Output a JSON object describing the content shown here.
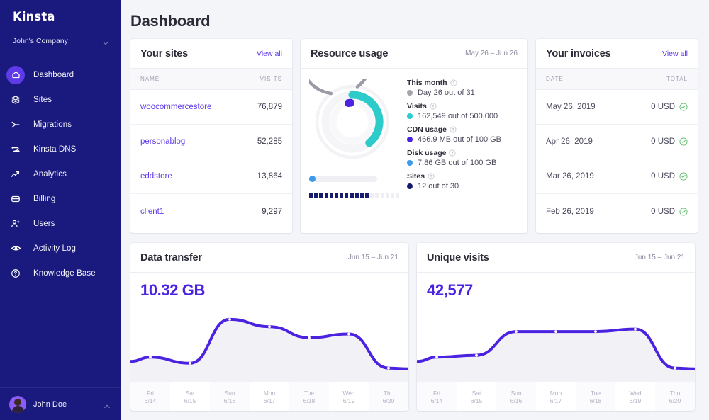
{
  "sidebar": {
    "logo": "Kinsta",
    "company": "John's Company",
    "company_chevron_icon": "chevron-down-icon",
    "items": [
      {
        "label": "Dashboard",
        "icon": "home-icon",
        "active": true
      },
      {
        "label": "Sites",
        "icon": "layers-icon",
        "active": false
      },
      {
        "label": "Migrations",
        "icon": "arrow-merge-icon",
        "active": false
      },
      {
        "label": "Kinsta DNS",
        "icon": "dns-network-icon",
        "active": false
      },
      {
        "label": "Analytics",
        "icon": "trend-up-icon",
        "active": false
      },
      {
        "label": "Billing",
        "icon": "credit-card-icon",
        "active": false
      },
      {
        "label": "Users",
        "icon": "user-plus-icon",
        "active": false
      },
      {
        "label": "Activity Log",
        "icon": "eye-icon",
        "active": false
      },
      {
        "label": "Knowledge Base",
        "icon": "question-circle-icon",
        "active": false
      }
    ],
    "user": {
      "name": "John Doe",
      "chevron_icon": "chevron-up-icon"
    }
  },
  "header": {
    "title": "Dashboard"
  },
  "sites_card": {
    "title": "Your sites",
    "view_all": "View all",
    "columns": [
      "NAME",
      "VISITS"
    ],
    "rows": [
      {
        "name": "woocommercestore",
        "visits": "76,879"
      },
      {
        "name": "personablog",
        "visits": "52,285"
      },
      {
        "name": "eddstore",
        "visits": "13,864"
      },
      {
        "name": "client1",
        "visits": "9,297"
      }
    ]
  },
  "resource_card": {
    "title": "Resource usage",
    "date_range": "May 26 – Jun 26",
    "help_icon": "question-circle-icon",
    "metrics": [
      {
        "label": "This month",
        "value": "Day 26 out of 31",
        "color": "#a3a3ad",
        "fraction": 0.839
      },
      {
        "label": "Visits",
        "value": "162,549 out of 500,000",
        "color": "#2ecbcb",
        "fraction": 0.325
      },
      {
        "label": "CDN usage",
        "value": "466.9 MB out of 100 GB",
        "color": "#4a22e0",
        "fraction": 0.0047
      },
      {
        "label": "Disk usage",
        "value": "7.86 GB out of 100 GB",
        "color": "#3b9aea",
        "fraction": 0.0786
      },
      {
        "label": "Sites",
        "value": "12 out of 30",
        "color": "#151b6e",
        "fraction": 0.4
      }
    ],
    "sites_segments_total": 18,
    "sites_segments_filled": 12
  },
  "invoices_card": {
    "title": "Your invoices",
    "view_all": "View all",
    "columns": [
      "DATE",
      "TOTAL"
    ],
    "status_icon": "check-circle-icon",
    "rows": [
      {
        "date": "May 26, 2019",
        "total": "0 USD"
      },
      {
        "date": "Apr 26, 2019",
        "total": "0 USD"
      },
      {
        "date": "Mar 26, 2019",
        "total": "0 USD"
      },
      {
        "date": "Feb 26, 2019",
        "total": "0 USD"
      }
    ]
  },
  "chart_data": [
    {
      "type": "area",
      "title": "Data transfer",
      "subtitle": "Jun 15 – Jun 21",
      "value_label": "10.32 GB",
      "xlabel": "",
      "ylabel": "",
      "categories": [
        "Fri",
        "Sat",
        "Sun",
        "Mon",
        "Tue",
        "Wed",
        "Thu"
      ],
      "tick_dates": [
        "6/14",
        "6/15",
        "6/16",
        "6/17",
        "6/18",
        "6/19",
        "6/20"
      ],
      "x": [
        0,
        1,
        2,
        3,
        4,
        5,
        6
      ],
      "values": [
        0.3,
        0.2,
        0.92,
        0.8,
        0.62,
        0.68,
        0.12
      ],
      "ylim": [
        0,
        1
      ],
      "grid": false,
      "legend": "none",
      "line_color": "#4a22e0",
      "fill_color": "#f2f2f6"
    },
    {
      "type": "area",
      "title": "Unique visits",
      "subtitle": "Jun 15 – Jun 21",
      "value_label": "42,577",
      "xlabel": "",
      "ylabel": "",
      "categories": [
        "Fri",
        "Sat",
        "Sun",
        "Mon",
        "Tue",
        "Wed",
        "Thu"
      ],
      "tick_dates": [
        "6/14",
        "6/15",
        "6/16",
        "6/17",
        "6/18",
        "6/19",
        "6/20"
      ],
      "x": [
        0,
        1,
        2,
        3,
        4,
        5,
        6
      ],
      "values": [
        0.3,
        0.33,
        0.72,
        0.72,
        0.72,
        0.76,
        0.12
      ],
      "ylim": [
        0,
        1
      ],
      "grid": false,
      "legend": "none",
      "line_color": "#4a22e0",
      "fill_color": "#f2f2f6"
    }
  ]
}
